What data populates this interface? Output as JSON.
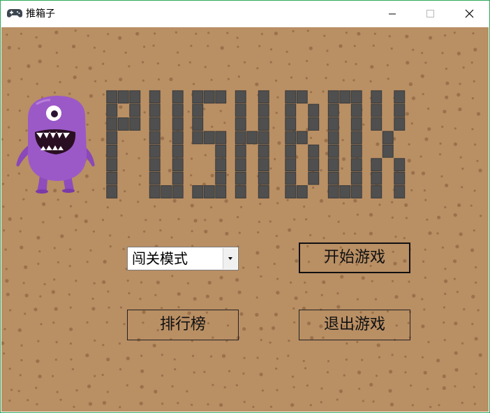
{
  "window": {
    "title": "推箱子",
    "icon": "gamepad-icon",
    "controls": [
      "minimize-icon",
      "maximize-icon",
      "close-icon"
    ]
  },
  "logo": {
    "text": "PUSH BOX"
  },
  "mode_select": {
    "selected": "闯关模式"
  },
  "buttons": {
    "start": "开始游戏",
    "leaderboard": "排行榜",
    "exit": "退出游戏"
  },
  "colors": {
    "background": "#b98f64",
    "dots": "#8d6441",
    "logo_block": "#4f4f4f",
    "monster": "#9b59c8",
    "border": "#2fa85a"
  }
}
